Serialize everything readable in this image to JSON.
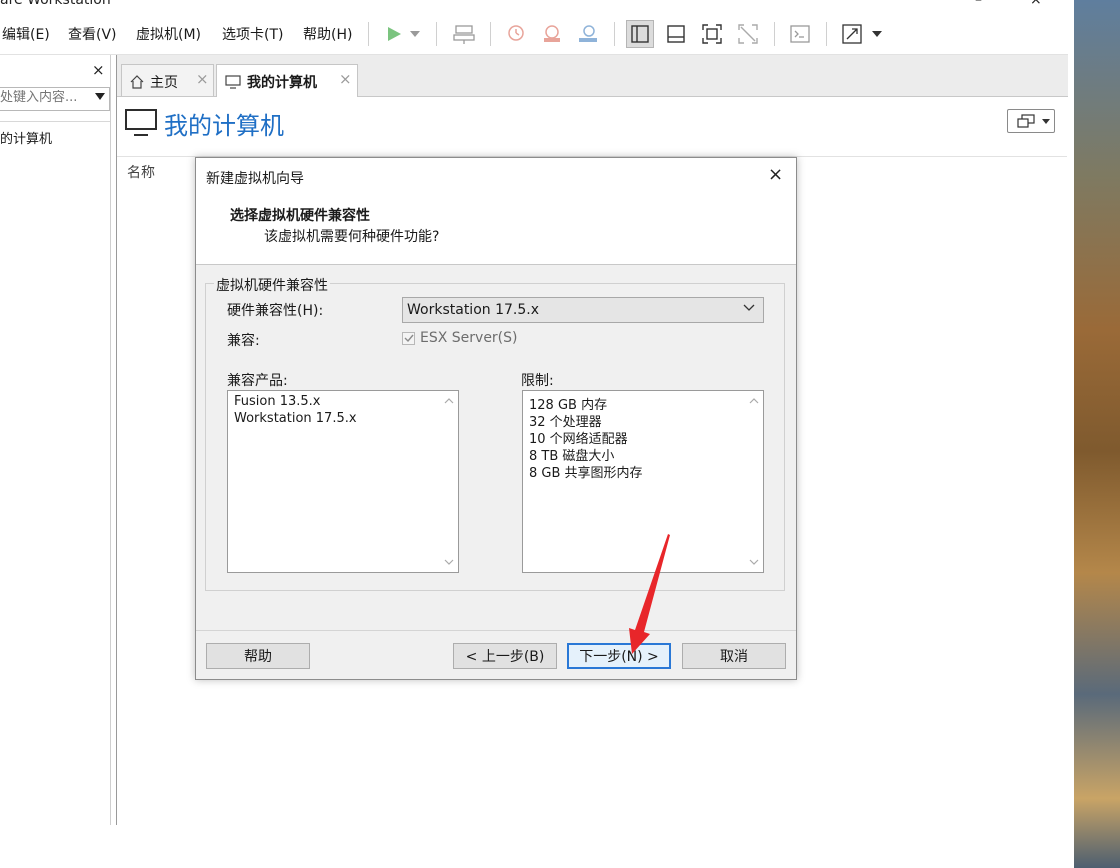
{
  "window": {
    "title": "are Workstation",
    "minimize_glyph": "–",
    "close_glyph": "×"
  },
  "menubar": {
    "items": [
      {
        "label": "编辑(E)"
      },
      {
        "label": "查看(V)"
      },
      {
        "label": "虚拟机(M)"
      },
      {
        "label": "选项卡(T)"
      },
      {
        "label": "帮助(H)"
      }
    ],
    "toolbar_icons": [
      "play-icon",
      "dropdown-arrow-icon",
      "send-keys-icon",
      "snapshot-icon",
      "revert-snapshot-icon",
      "snapshot-manager-icon",
      "library-view-icon",
      "thumbnail-bar-icon",
      "fullscreen-icon",
      "unity-icon",
      "console-icon",
      "stretch-icon"
    ]
  },
  "sidebar": {
    "close_glyph": "×",
    "search_placeholder": "处键入内容...",
    "tree_item": "的计算机"
  },
  "tabs": [
    {
      "label": "主页",
      "icon": "home-icon",
      "close": "×"
    },
    {
      "label": "我的计算机",
      "icon": "monitor-icon",
      "close": "×"
    }
  ],
  "page": {
    "title": "我的计算机",
    "column_name": "名称"
  },
  "dialog": {
    "title": "新建虚拟机向导",
    "close_glyph": "×",
    "heading": "选择虚拟机硬件兼容性",
    "subheading": "该虚拟机需要何种硬件功能?",
    "group_label": "虚拟机硬件兼容性",
    "compat_label": "硬件兼容性(H):",
    "compat_value": "Workstation 17.5.x",
    "compatible_label": "兼容:",
    "esx_label": "ESX Server(S)",
    "products_label": "兼容产品:",
    "products": [
      "Fusion 13.5.x",
      "Workstation 17.5.x"
    ],
    "limits_label": "限制:",
    "limits": [
      "128 GB 内存",
      "32 个处理器",
      "10 个网络适配器",
      "8 TB 磁盘大小",
      "8 GB 共享图形内存"
    ],
    "buttons": {
      "help": "帮助",
      "back": "< 上一步(B)",
      "next": "下一步(N) >",
      "cancel": "取消"
    }
  },
  "colors": {
    "accent_blue": "#1f6fc5",
    "primary_border": "#2a78d6",
    "annotation_red": "#e8262a",
    "play_green": "#4caf50"
  }
}
